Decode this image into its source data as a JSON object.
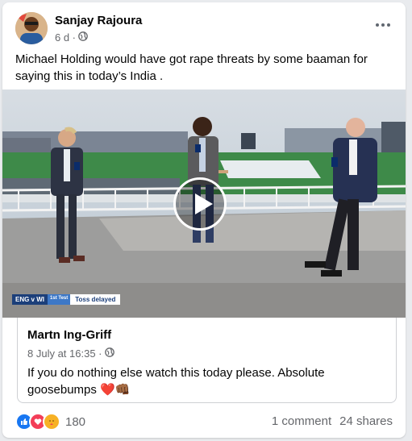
{
  "post": {
    "author": "Sanjay Rajoura",
    "time": "6 d ·",
    "text": "Michael Holding would have got rape threats by some baaman for saying this in today’s India ."
  },
  "video": {
    "ticker_match": "ENG v WI",
    "ticker_test": "1st Test",
    "ticker_status": "Toss delayed"
  },
  "shared": {
    "author": "Martn Ing-Griff",
    "time": "8 July at 16:35 ·",
    "text": "If you do nothing else watch this today please. Absolute goosebumps ❤️👊🏾"
  },
  "footer": {
    "reaction_count": "180",
    "comments": "1 comment",
    "shares": "24 shares"
  },
  "colors": {
    "like": "#1877f2",
    "love": "#f33e58",
    "care": "#f7b125"
  }
}
